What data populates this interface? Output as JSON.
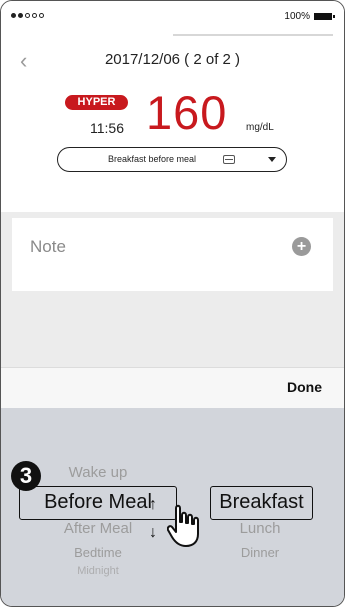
{
  "status_bar": {
    "battery_percent": "100%"
  },
  "header": {
    "date_title": "2017/12/06 ( 2 of 2 )"
  },
  "reading": {
    "badge": "HYPER",
    "time": "11:56",
    "value": "160",
    "unit": "mg/dL"
  },
  "meal_select": {
    "label": "Breakfast before meal"
  },
  "note": {
    "label": "Note"
  },
  "actions": {
    "done_label": "Done"
  },
  "tutorial": {
    "step_number": "3"
  },
  "picker": {
    "left_column": [
      "Wake up",
      "Before Meal",
      "After Meal",
      "Bedtime",
      "Midnight"
    ],
    "right_column": [
      "Breakfast",
      "Lunch",
      "Dinner"
    ]
  }
}
